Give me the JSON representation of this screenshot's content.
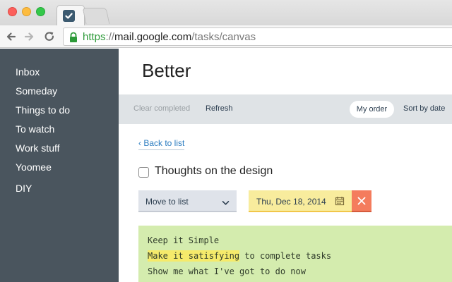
{
  "browser": {
    "url": {
      "scheme": "https",
      "separator": "://",
      "host": "mail.google.com",
      "path": "/tasks/canvas"
    }
  },
  "sidebar": {
    "items": [
      {
        "label": "Inbox"
      },
      {
        "label": "Someday"
      },
      {
        "label": "Things to do"
      },
      {
        "label": "To watch"
      },
      {
        "label": "Work stuff"
      },
      {
        "label": "Yoomee"
      },
      {
        "label": "DIY"
      }
    ]
  },
  "main": {
    "list_title": "Better",
    "actions": {
      "clear_completed": "Clear completed",
      "refresh": "Refresh",
      "my_order": "My order",
      "sort_by_date": "Sort by date"
    },
    "back_link": "‹ Back to list",
    "task": {
      "title": "Thoughts on the design",
      "completed": false
    },
    "move_to_list": "Move to list",
    "due_date": "Thu, Dec 18, 2014",
    "notes": {
      "line1": "Keep it Simple",
      "line2_highlight": "Make it satisfying",
      "line2_rest": " to complete tasks",
      "line3": "Show me what I've got to do now"
    }
  },
  "colors": {
    "sidebar_bg": "#4a555e",
    "actionbar_bg": "#dfe3e6",
    "date_bg": "#f8ec9d",
    "date_clear_bg": "#f47c5d",
    "notes_bg": "#d4ecae",
    "highlight": "#f5ea6b",
    "link": "#2b7cc0",
    "url_scheme": "#2d9a39"
  },
  "icons": {
    "favicon": "checkmark-icon",
    "back": "arrow-left-icon",
    "forward": "arrow-right-icon",
    "reload": "reload-icon",
    "lock": "lock-icon",
    "select": "chevron-down-icon",
    "calendar": "calendar-icon",
    "clear": "close-icon"
  }
}
